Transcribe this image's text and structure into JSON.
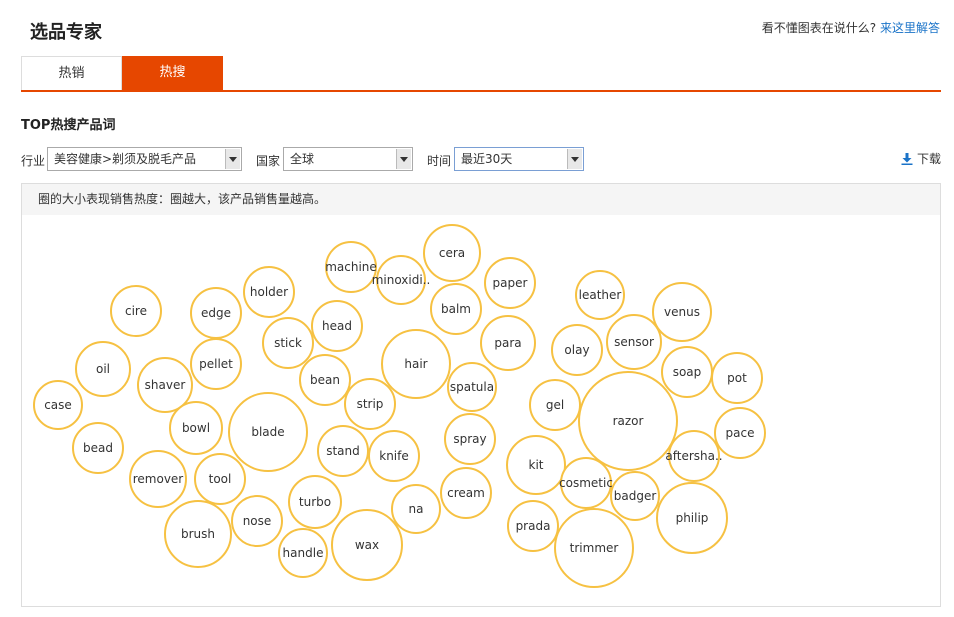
{
  "header": {
    "title": "选品专家",
    "help_text": "看不懂图表在说什么?",
    "help_link": "来这里解答"
  },
  "tabs": [
    {
      "label": "热销",
      "active": false
    },
    {
      "label": "热搜",
      "active": true
    }
  ],
  "section_title": "TOP热搜产品词",
  "filters": {
    "industry_label": "行业",
    "industry_value": "美容健康>剃须及脱毛产品",
    "country_label": "国家",
    "country_value": "全球",
    "time_label": "时间",
    "time_value": "最近30天"
  },
  "download_label": "下载",
  "panel_note": "圈的大小表现销售热度：圈越大，该产品销售量越高。",
  "colors": {
    "accent": "#e64700",
    "bubble_stroke": "#f6c142",
    "link": "#1a73c8"
  },
  "chart_data": {
    "type": "bubble",
    "words": [
      "case",
      "bead",
      "oil",
      "cire",
      "remover",
      "shaver",
      "pellet",
      "edge",
      "holder",
      "bowl",
      "tool",
      "brush",
      "nose",
      "blade",
      "stick",
      "head",
      "machine",
      "minoxidi..",
      "cera",
      "bean",
      "strip",
      "hair",
      "stand",
      "knife",
      "turbo",
      "handle",
      "wax",
      "na",
      "cream",
      "spray",
      "spatula",
      "balm",
      "para",
      "paper",
      "gel",
      "kit",
      "olay",
      "leather",
      "sensor",
      "venus",
      "soap",
      "pot",
      "razor",
      "aftersha..",
      "pace",
      "cosmetic",
      "badger",
      "prada",
      "trimmer",
      "philip"
    ]
  }
}
